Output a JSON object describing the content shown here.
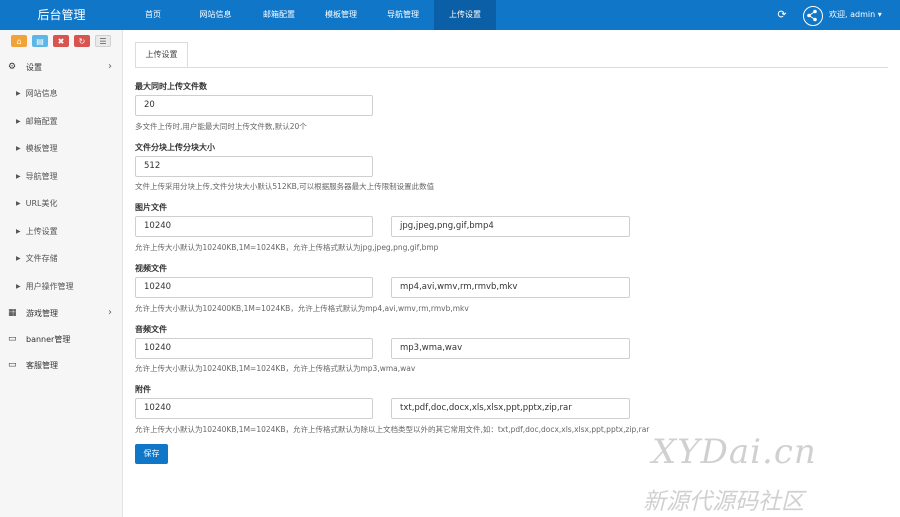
{
  "header": {
    "brand": "后台管理",
    "nav": [
      {
        "label": "首页",
        "active": false
      },
      {
        "label": "网站信息",
        "active": false
      },
      {
        "label": "邮箱配置",
        "active": false
      },
      {
        "label": "模板管理",
        "active": false
      },
      {
        "label": "导航管理",
        "active": false
      },
      {
        "label": "上传设置",
        "active": true
      }
    ],
    "refresh_icon": "refresh-icon",
    "user_icon": "share-icon",
    "user_label": "欢迎, admin ▾"
  },
  "sidebar": {
    "shortcuts": [
      "home-icon",
      "file-icon",
      "trash-icon",
      "recycle-icon",
      "list-icon"
    ],
    "sections": [
      {
        "label": "设置",
        "icon": "gears-icon",
        "expanded": true
      },
      {
        "label": "游戏管理",
        "icon": "grid-icon",
        "expanded": false
      },
      {
        "label": "banner管理",
        "icon": "monitor-icon"
      },
      {
        "label": "客服管理",
        "icon": "monitor-icon"
      }
    ],
    "settings_items": [
      "网站信息",
      "邮箱配置",
      "模板管理",
      "导航管理",
      "URL美化",
      "上传设置",
      "文件存储",
      "用户操作管理"
    ]
  },
  "main": {
    "tab": "上传设置",
    "max_files": {
      "label": "最大同时上传文件数",
      "value": "20",
      "hint": "多文件上传时,用户能最大同时上传文件数,默认20个"
    },
    "chunk_size": {
      "label": "文件分块上传分块大小",
      "value": "512",
      "hint": "文件上传采用分块上传,文件分块大小默认512KB,可以根据服务器最大上传限制设置此数值"
    },
    "image": {
      "label": "图片文件",
      "size": "10240",
      "formats": "jpg,jpeg,png,gif,bmp4",
      "hint": "允许上传大小默认为10240KB,1M=1024KB，允许上传格式默认为jpg,jpeg,png,gif,bmp"
    },
    "video": {
      "label": "视频文件",
      "size": "10240",
      "formats": "mp4,avi,wmv,rm,rmvb,mkv",
      "hint": "允许上传大小默认为102400KB,1M=1024KB，允许上传格式默认为mp4,avi,wmv,rm,rmvb,mkv"
    },
    "audio": {
      "label": "音频文件",
      "size": "10240",
      "formats": "mp3,wma,wav",
      "hint": "允许上传大小默认为10240KB,1M=1024KB，允许上传格式默认为mp3,wma,wav"
    },
    "attachment": {
      "label": "附件",
      "size": "10240",
      "formats": "txt,pdf,doc,docx,xls,xlsx,ppt,pptx,zip,rar",
      "hint": "允许上传大小默认为10240KB,1M=1024KB，允许上传格式默认为除以上文档类型以外的其它常用文件,如：txt,pdf,doc,docx,xls,xlsx,ppt,pptx,zip,rar"
    },
    "save_label": "保存"
  },
  "watermark": {
    "line1": "XYDai.cn",
    "line2": "新源代源码社区"
  },
  "colors": {
    "header": "#0f76c8",
    "nav_active": "#0b5fa6",
    "save_button": "#0f76c8"
  }
}
